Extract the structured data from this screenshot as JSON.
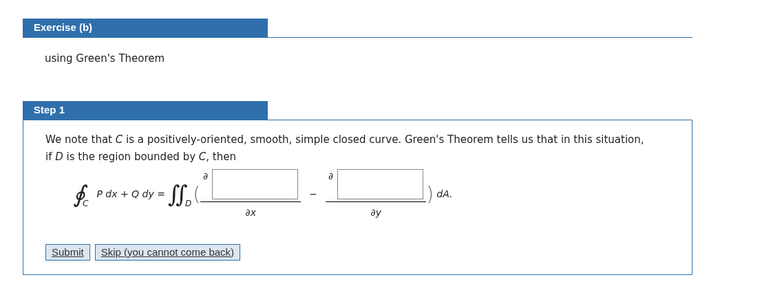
{
  "exercise": {
    "title": "Exercise (b)",
    "text": "using Green's Theorem"
  },
  "step": {
    "title": "Step 1",
    "paragraph": "We note that *C* is a positively-oriented, smooth, simple closed curve. Green's Theorem tells us that in this situation, if *D* is the region bounded by *C*, then",
    "formula": {
      "contour_symbol": "∮",
      "contour_subscript": "C",
      "lhs": "*P dx* + *Q dy* =",
      "double_integral": "∬",
      "region_subscript": "D",
      "open_paren": "(",
      "fractions": [
        {
          "numerator": "∂",
          "denominator": "∂x"
        },
        {
          "numerator": "∂",
          "denominator": "∂y"
        }
      ],
      "minus": "−",
      "close_paren": ")",
      "tail": "dA."
    }
  },
  "buttons": [
    {
      "label": "Submit"
    },
    {
      "label": "Skip (you cannot come back)"
    }
  ]
}
